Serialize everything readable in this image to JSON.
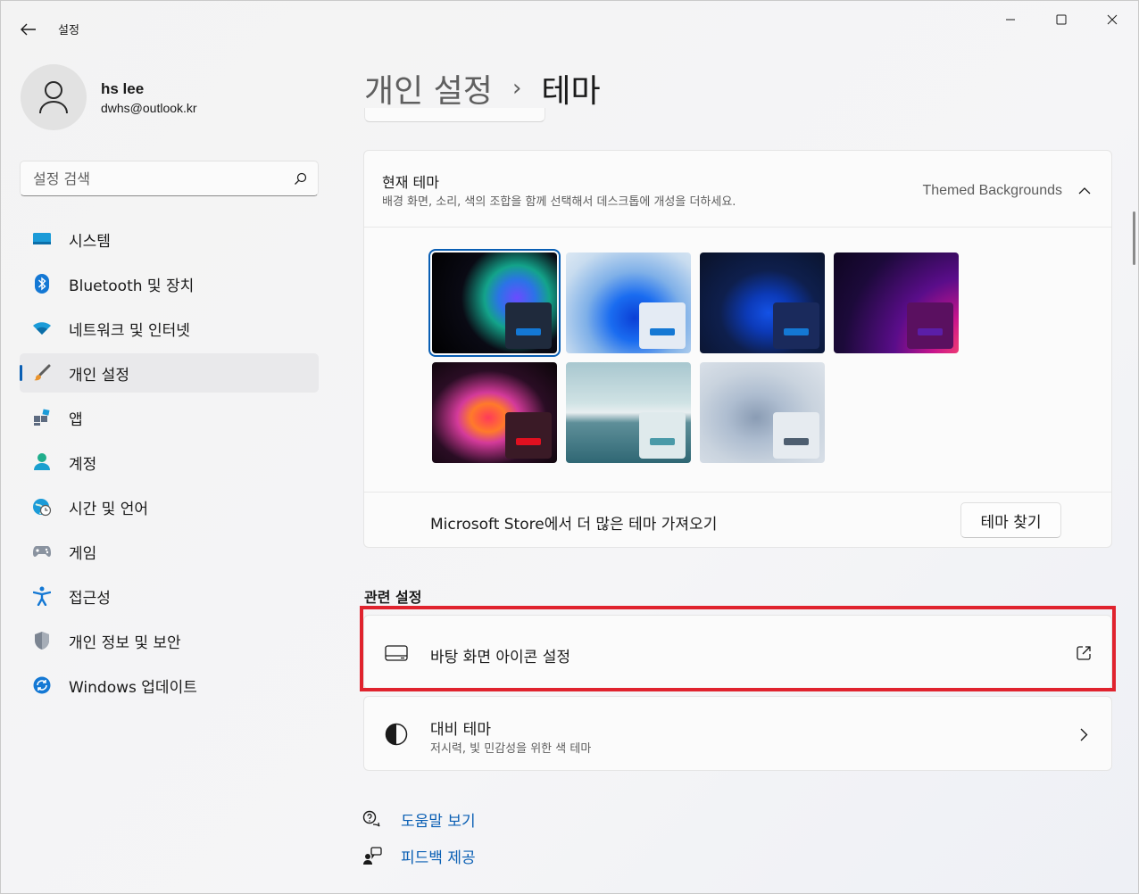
{
  "window": {
    "app_title": "설정",
    "controls": {
      "minimize": "minimize",
      "maximize": "maximize",
      "close": "close"
    }
  },
  "profile": {
    "name": "hs lee",
    "email": "dwhs@outlook.kr"
  },
  "search": {
    "placeholder": "설정 검색"
  },
  "nav": {
    "items": [
      {
        "label": "시스템",
        "icon": "monitor-icon"
      },
      {
        "label": "Bluetooth 및 장치",
        "icon": "bluetooth-icon"
      },
      {
        "label": "네트워크 및 인터넷",
        "icon": "wifi-icon"
      },
      {
        "label": "개인 설정",
        "icon": "brush-icon",
        "active": true
      },
      {
        "label": "앱",
        "icon": "apps-icon"
      },
      {
        "label": "계정",
        "icon": "account-icon"
      },
      {
        "label": "시간 및 언어",
        "icon": "globe-clock-icon"
      },
      {
        "label": "게임",
        "icon": "gamepad-icon"
      },
      {
        "label": "접근성",
        "icon": "accessibility-icon"
      },
      {
        "label": "개인 정보 및 보안",
        "icon": "shield-icon"
      },
      {
        "label": "Windows 업데이트",
        "icon": "update-icon"
      }
    ]
  },
  "page": {
    "parent": "개인 설정",
    "separator": "›",
    "current": "테마"
  },
  "current_theme": {
    "title": "현재 테마",
    "description": "배경 화면, 소리, 색의 조합을 함께 선택해서 데스크톱에 개성을 더하세요.",
    "value": "Themed Backgrounds"
  },
  "store": {
    "text": "Microsoft Store에서 더 많은 테마 가져오기",
    "button": "테마 찾기"
  },
  "related": {
    "title": "관련 설정",
    "desktop_icons": {
      "title": "바탕 화면 아이콘 설정"
    },
    "contrast": {
      "title": "대비 테마",
      "subtitle": "저시력, 빛 민감성을 위한 색 테마"
    }
  },
  "help": {
    "get_help": "도움말 보기",
    "feedback": "피드백 제공"
  },
  "colors": {
    "accent": "#0a5fb4",
    "highlight": "#e0232e"
  }
}
